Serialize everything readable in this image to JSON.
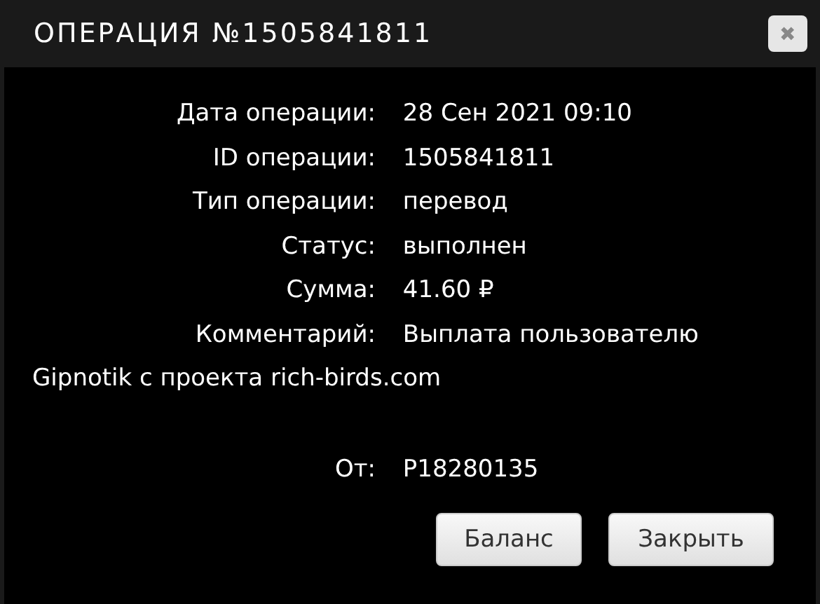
{
  "window": {
    "title": "ОПЕРАЦИЯ №1505841811",
    "close_icon": "✖"
  },
  "fields": [
    {
      "label": "Дата операции:",
      "value": "28 Сен 2021 09:10"
    },
    {
      "label": "ID операции:",
      "value": "1505841811"
    },
    {
      "label": "Тип операции:",
      "value": "перевод"
    },
    {
      "label": "Статус:",
      "value": "выполнен"
    },
    {
      "label": "Сумма:",
      "value": "41.60 ₽"
    },
    {
      "label": "Комментарий:",
      "value": "Выплата пользователю",
      "value_continued": "Gipnotik с проекта rich-birds.com"
    },
    {
      "label": "От:",
      "value": "P18280135"
    }
  ],
  "buttons": [
    "Баланс",
    "Закрыть"
  ]
}
